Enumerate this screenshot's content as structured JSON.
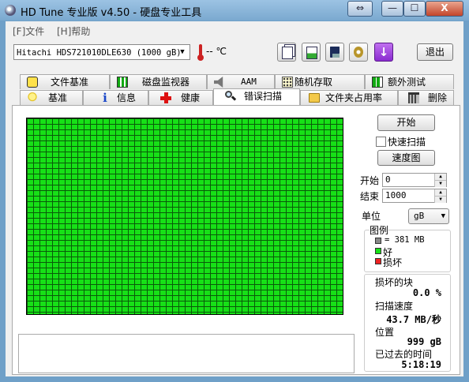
{
  "window": {
    "title": "HD Tune 专业版 v4.50 - 硬盘专业工具",
    "controls": {
      "resize": "⇔",
      "minimize": "—",
      "maximize": "☐",
      "close": "X"
    }
  },
  "menu": {
    "file": "[F]文件",
    "help": "[H]帮助"
  },
  "toolbar": {
    "drive": "Hitachi HDS721010DLE630  (1000 gB)",
    "temperature": "-- ℃",
    "exit": "退出",
    "icons": [
      "copy-text-icon",
      "copy-screen-icon",
      "save-icon",
      "options-icon",
      "download-icon"
    ]
  },
  "tabs": {
    "row1": [
      "文件基准",
      "磁盘监视器",
      "AAM",
      "随机存取",
      "额外测试"
    ],
    "row2": [
      "基准",
      "信息",
      "健康",
      "错误扫描",
      "文件夹占用率",
      "删除"
    ],
    "active": "错误扫描"
  },
  "scan": {
    "start_button": "开始",
    "quick_scan_label": "快速扫描",
    "quick_scan_checked": false,
    "map_button": "速度图",
    "start_label": "开始",
    "start_value": "0",
    "end_label": "结束",
    "end_value": "1000",
    "unit_label": "单位",
    "unit_value": "gB",
    "legend": {
      "title": "图例",
      "block_size": "= 381 MB",
      "good": "好",
      "bad": "损坏",
      "colors": {
        "block": "#888888",
        "good": "#17e017",
        "bad": "#ee2222"
      }
    },
    "stats": {
      "damaged_label": "损坏的块",
      "damaged_value": "0.0 %",
      "speed_label": "扫描速度",
      "speed_value": "43.7 MB/秒",
      "position_label": "位置",
      "position_value": "999 gB",
      "elapsed_label": "已过去的时间",
      "elapsed_value": "5:18:19"
    }
  }
}
